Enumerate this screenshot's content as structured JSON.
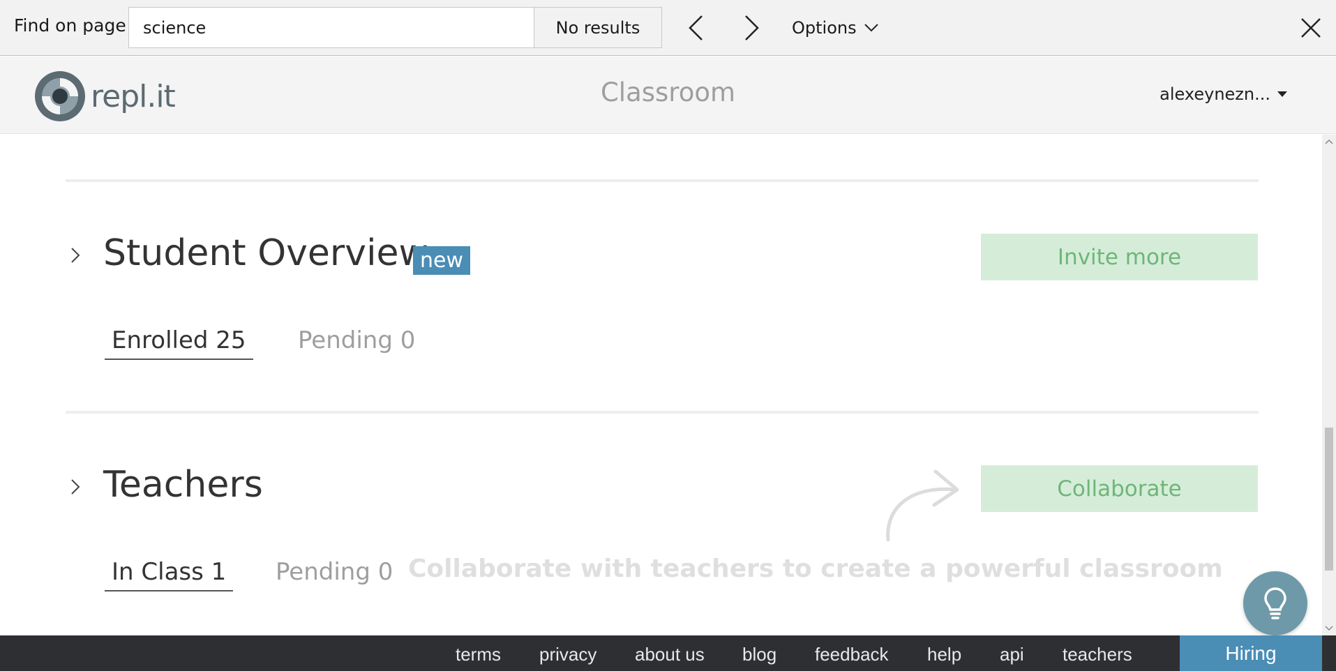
{
  "findbar": {
    "label": "Find on page",
    "query": "science",
    "results": "No results",
    "options_label": "Options"
  },
  "header": {
    "logo_text": "repl​.it",
    "title": "Classroom",
    "user": "alexeynezn..."
  },
  "students": {
    "title": "Student Overview",
    "badge": "new",
    "action": "Invite more",
    "tabs": [
      {
        "label": "Enrolled 25"
      },
      {
        "label": "Pending 0"
      }
    ]
  },
  "teachers": {
    "title": "Teachers",
    "action": "Collaborate",
    "tabs": [
      {
        "label": "In Class 1"
      },
      {
        "label": "Pending 0"
      }
    ],
    "hint": "Collaborate with teachers to create a powerful classroom"
  },
  "footer": {
    "links": [
      "terms",
      "privacy",
      "about us",
      "blog",
      "feedback",
      "help",
      "api",
      "teachers"
    ],
    "hiring": "Hiring"
  },
  "colors": {
    "accent_blue": "#4a8db5",
    "action_green_bg": "#d5edd8",
    "action_green_text": "#6fb57a",
    "footer_bg": "#2d2f33"
  }
}
